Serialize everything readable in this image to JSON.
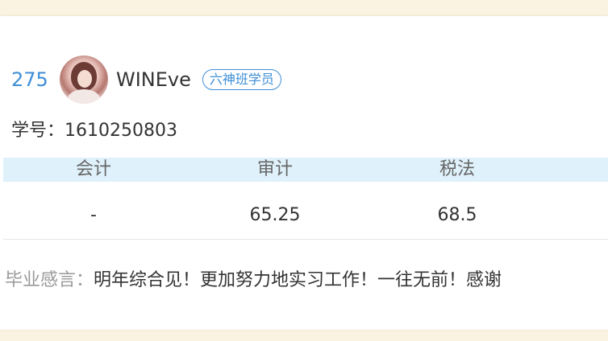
{
  "user": {
    "rank": "275",
    "username": "WINEve",
    "badge": "六神班学员",
    "student_id_label": "学号：",
    "student_id": "1610250803"
  },
  "scores": {
    "headers": [
      "会计",
      "审计",
      "税法"
    ],
    "values": [
      "-",
      "65.25",
      "68.5"
    ]
  },
  "message": {
    "label": "毕业感言：",
    "text": "明年综合见！更加努力地实习工作！一往无前！感谢"
  },
  "colors": {
    "accent_blue": "#3e8ed6",
    "header_bg": "#dff1fb",
    "page_bg": "#fbf3e1"
  }
}
